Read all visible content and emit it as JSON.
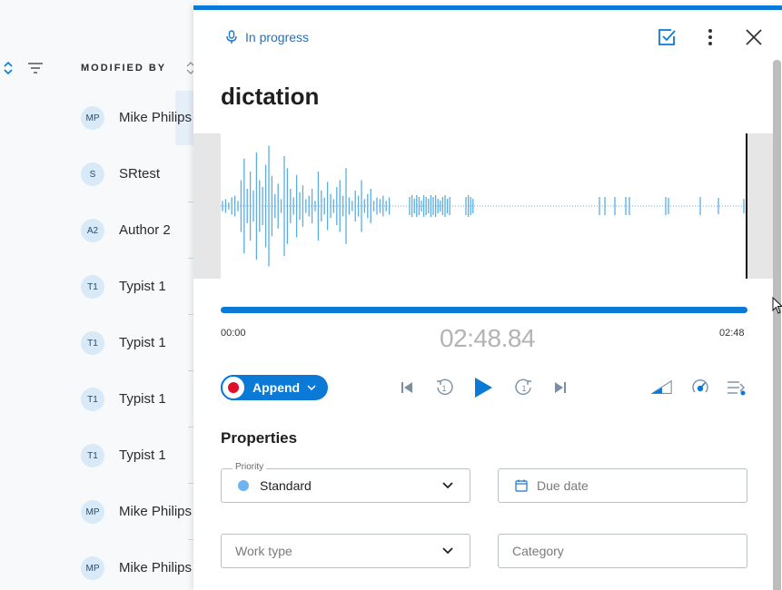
{
  "list": {
    "column_header": "MODIFIED BY",
    "rows": [
      {
        "initials": "MP",
        "name": "Mike Philips"
      },
      {
        "initials": "S",
        "name": "SRtest"
      },
      {
        "initials": "A2",
        "name": "Author 2"
      },
      {
        "initials": "T1",
        "name": "Typist 1"
      },
      {
        "initials": "T1",
        "name": "Typist 1"
      },
      {
        "initials": "T1",
        "name": "Typist 1"
      },
      {
        "initials": "T1",
        "name": "Typist 1"
      },
      {
        "initials": "MP",
        "name": "Mike Philips"
      },
      {
        "initials": "MP",
        "name": "Mike Philips"
      }
    ]
  },
  "panel": {
    "status": "In progress",
    "title": "dictation",
    "header_icons": [
      "checkbox-icon",
      "more-vertical-icon",
      "close-icon"
    ]
  },
  "player": {
    "time_start": "00:00",
    "time_current": "02:48.84",
    "time_end": "02:48",
    "progress": 1.0,
    "append_label": "Append",
    "controls": [
      "skip-back-icon",
      "rewind-1-icon",
      "play-icon",
      "forward-1-icon",
      "skip-forward-icon",
      "volume-icon",
      "speed-icon",
      "settings-icon"
    ]
  },
  "properties": {
    "title": "Properties",
    "priority": {
      "legend": "Priority",
      "value": "Standard"
    },
    "due_date": {
      "placeholder": "Due date"
    },
    "work_type": {
      "placeholder": "Work type"
    },
    "category": {
      "placeholder": "Category"
    }
  },
  "colors": {
    "accent": "#0a7ad6",
    "record": "#e0102a",
    "priority_dot": "#6fb3f0"
  }
}
